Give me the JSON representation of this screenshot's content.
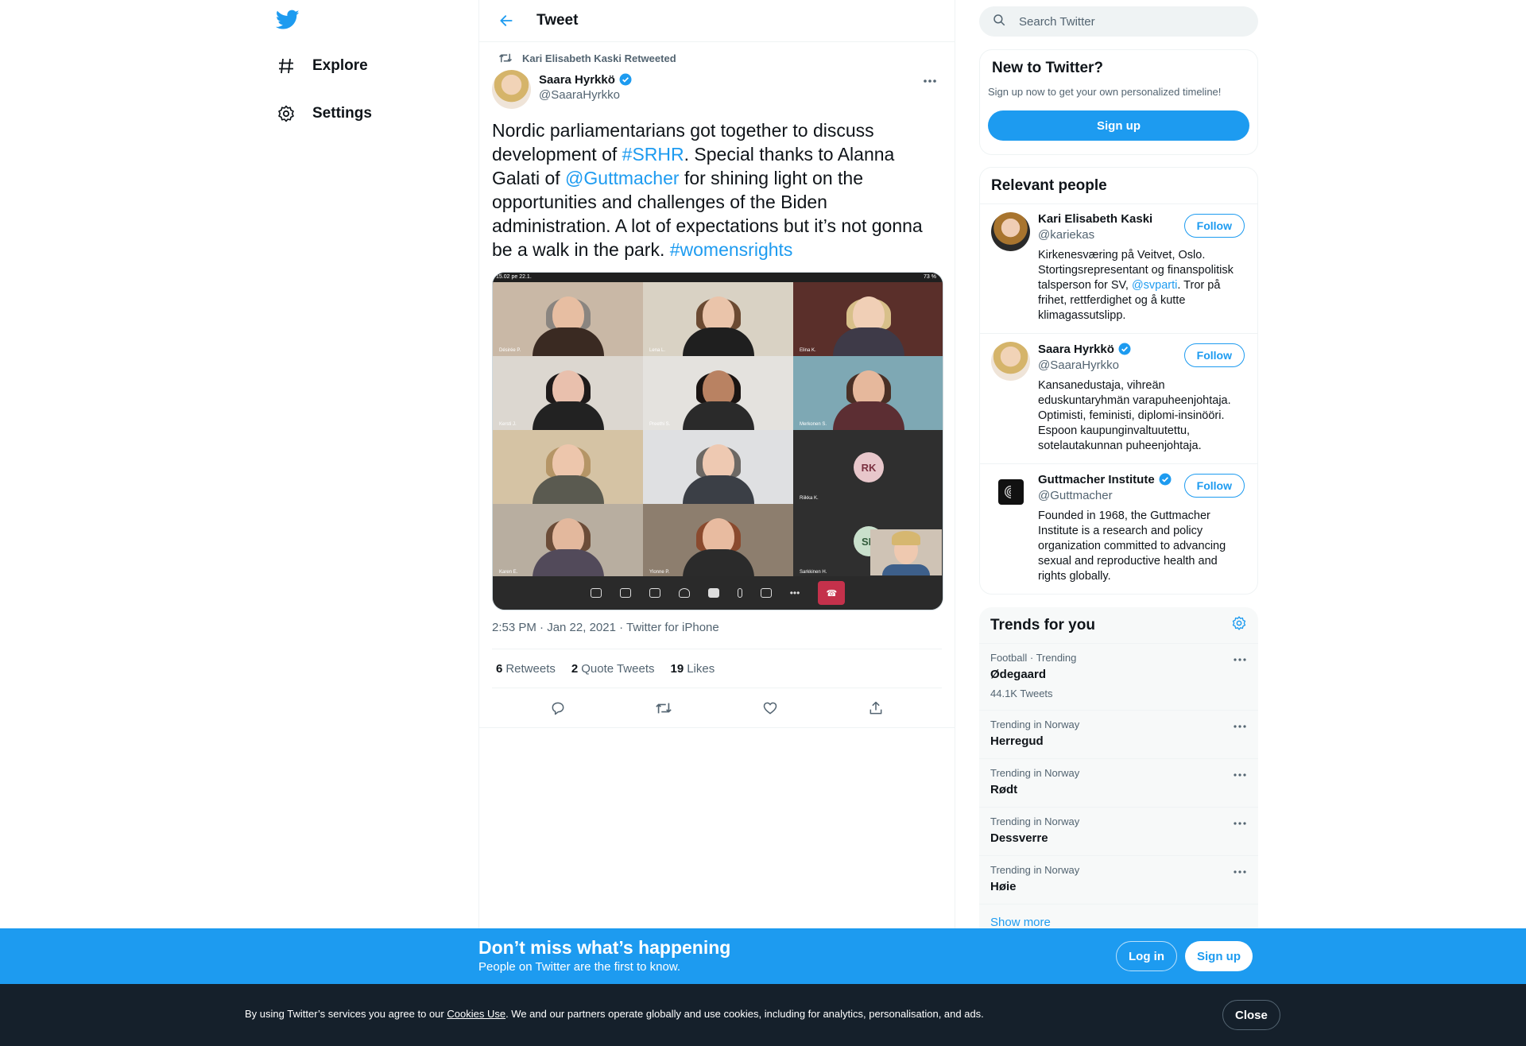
{
  "nav": {
    "items": [
      {
        "label": "Explore",
        "icon": "hashtag-icon"
      },
      {
        "label": "Settings",
        "icon": "gear-icon"
      }
    ]
  },
  "header": {
    "title": "Tweet"
  },
  "tweet": {
    "retweeted_by": "Kari Elisabeth Kaski Retweeted",
    "author_name": "Saara Hyrkkö",
    "author_handle": "@SaaraHyrkko",
    "text_parts": {
      "p1": "Nordic parliamentarians got together to discuss development of ",
      "hashtag1": "#SRHR",
      "p2": ". Special thanks to Alanna Galati of ",
      "mention1": "@Guttmacher",
      "p3": " for shining light on the opportunities and challenges of the Biden administration. A lot of expectations but it’s not gonna be a walk in the park. ",
      "hashtag2": "#womensrights"
    },
    "media": {
      "status_bar": "15.02  pe 22.1.",
      "status_right": "73 %",
      "tiles": [
        {
          "tag": "Désirée P."
        },
        {
          "tag": "Lena L."
        },
        {
          "tag": "Elina K."
        },
        {
          "tag": "Kersti J."
        },
        {
          "tag": "Preethi S."
        },
        {
          "tag": "Merkonen S."
        },
        {
          "tag": ""
        },
        {
          "tag": ""
        },
        {
          "tag": "Riikka K."
        },
        {
          "tag": "Karen E."
        },
        {
          "tag": "Ylonne P."
        },
        {
          "tag": "Sarkkinen H."
        }
      ],
      "initials_1": "RK",
      "initials_2": "SH"
    },
    "meta": {
      "time": "2:53 PM · Jan 22, 2021",
      "source": "Twitter for iPhone"
    },
    "stats": {
      "retweets_count": "6",
      "retweets_label": "Retweets",
      "quotes_count": "2",
      "quotes_label": "Quote Tweets",
      "likes_count": "19",
      "likes_label": "Likes"
    }
  },
  "search": {
    "placeholder": "Search Twitter"
  },
  "new_to_twitter": {
    "title": "New to Twitter?",
    "subtitle": "Sign up now to get your own personalized timeline!",
    "button": "Sign up"
  },
  "relevant": {
    "title": "Relevant people",
    "follow_label": "Follow",
    "people": [
      {
        "name": "Kari Elisabeth Kaski",
        "handle": "@kariekas",
        "bio_1": "Kirkenesværing på Veitvet, Oslo. Stortingsrepresentant og finanspolitisk talsperson for SV, ",
        "bio_link": "@svparti",
        "bio_2": ". Tror på frihet, rettferdighet og å kutte klimagassutslipp."
      },
      {
        "name": "Saara Hyrkkö",
        "handle": "@SaaraHyrkko",
        "bio_1": "Kansanedustaja, vihreän eduskuntaryhmän varapuheenjohtaja. Optimisti, feministi, diplomi-insinööri. Espoon kaupunginvaltuutettu, sotelautakunnan puheenjohtaja."
      },
      {
        "name": "Guttmacher Institute",
        "handle": "@Guttmacher",
        "bio_1": "Founded in 1968, the Guttmacher Institute is a research and policy organization committed to advancing sexual and reproductive health and rights globally."
      }
    ]
  },
  "trends": {
    "title": "Trends for you",
    "items": [
      {
        "context": "Football · Trending",
        "name": "Ødegaard",
        "count": "44.1K Tweets"
      },
      {
        "context": "Trending in Norway",
        "name": "Herregud"
      },
      {
        "context": "Trending in Norway",
        "name": "Rødt"
      },
      {
        "context": "Trending in Norway",
        "name": "Dessverre"
      },
      {
        "context": "Trending in Norway",
        "name": "Høie"
      }
    ],
    "show_more": "Show more"
  },
  "banner": {
    "title": "Don’t miss what’s happening",
    "subtitle": "People on Twitter are the first to know.",
    "login": "Log in",
    "signup": "Sign up"
  },
  "cookie": {
    "text_1": "By using Twitter’s services you agree to our ",
    "link": "Cookies Use",
    "text_2": ". We and our partners operate globally and use cookies, including for analytics, personalisation, and ads.",
    "close": "Close"
  },
  "colors": {
    "accent": "#1d9bf0",
    "banner": "#1d9bf0",
    "cookie_bg": "#15202b",
    "hangup": "#c4314b"
  }
}
